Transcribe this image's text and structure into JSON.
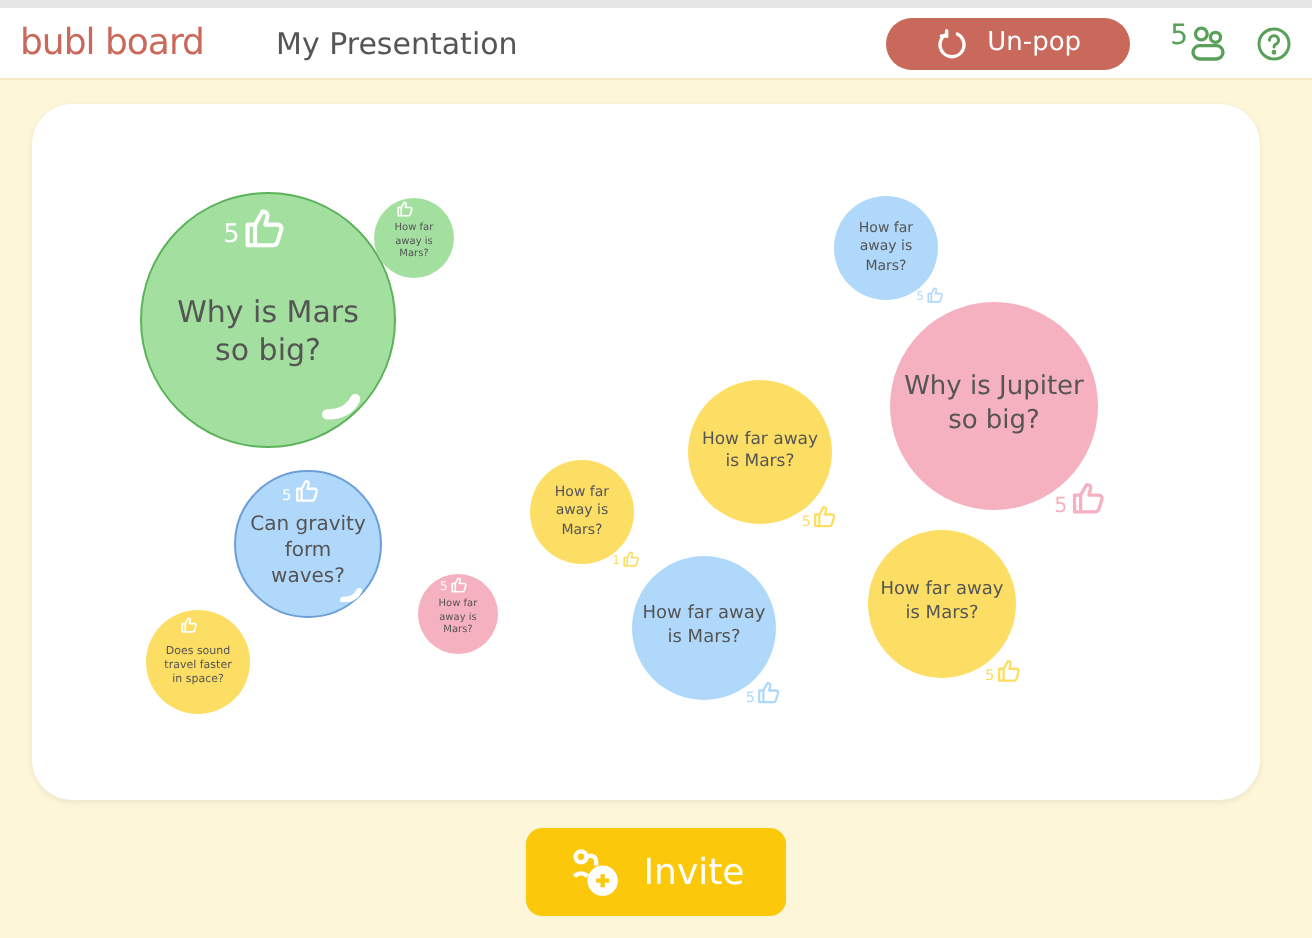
{
  "header": {
    "logo": "bubl board",
    "title": "My Presentation",
    "unpop_button": "Un-pop",
    "participants": "5"
  },
  "bubbles": [
    {
      "text": "Why is Mars so big?",
      "color": "#a3e0a0",
      "likes": "5"
    },
    {
      "text": "How far away is Mars?",
      "color": "#a3e0a0"
    },
    {
      "text": "Can gravity form waves?",
      "color": "#b0d8fb",
      "likes": "5"
    },
    {
      "text": "Does sound travel faster in space?",
      "color": "#fcde64"
    },
    {
      "text": "How far away is Mars?",
      "color": "#f6b1c1",
      "likes": "5"
    },
    {
      "text": "How far away is Mars?",
      "color": "#fcde64",
      "likes": "1"
    },
    {
      "text": "How far away is Mars?",
      "color": "#fcde64",
      "likes": "5"
    },
    {
      "text": "How far away is Mars?",
      "color": "#b0d8fb",
      "likes": "5"
    },
    {
      "text": "How far away is Mars?",
      "color": "#b0d8fb",
      "likes": "5"
    },
    {
      "text": "Why is Jupiter so big?",
      "color": "#f6b1c1",
      "likes": "5"
    },
    {
      "text": "How far away is Mars?",
      "color": "#fcde64",
      "likes": "5"
    }
  ],
  "invite_button": "Invite"
}
